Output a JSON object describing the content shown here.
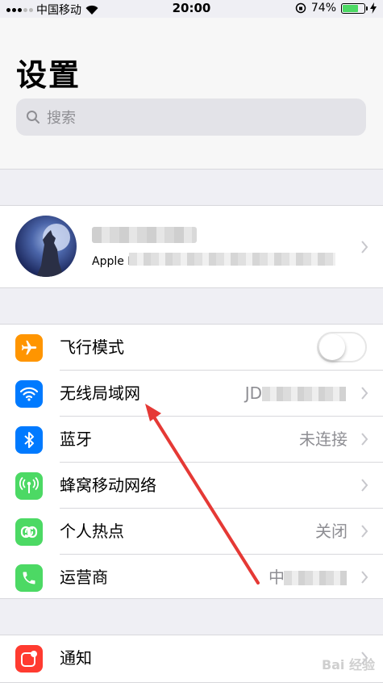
{
  "status_bar": {
    "carrier": "中国移动",
    "time": "20:00",
    "battery": "74%",
    "battery_level": 0.74
  },
  "header": {
    "title": "设置",
    "search_placeholder": "搜索"
  },
  "profile": {
    "subtitle": "Apple ID、iCloud、iTunes"
  },
  "settings": [
    {
      "label": "飞行模式",
      "value": "",
      "icon": "airplane-icon",
      "color": "#ff9500"
    },
    {
      "label": "无线局域网",
      "value": "JD",
      "icon": "wifi-icon",
      "color": "#007aff"
    },
    {
      "label": "蓝牙",
      "value": "未连接",
      "icon": "bluetooth-icon",
      "color": "#007aff"
    },
    {
      "label": "蜂窝移动网络",
      "value": "",
      "icon": "antenna-icon",
      "color": "#4cd964"
    },
    {
      "label": "个人热点",
      "value": "关闭",
      "icon": "hotspot-icon",
      "color": "#4cd964"
    },
    {
      "label": "运营商",
      "value": "中",
      "icon": "phone-icon",
      "color": "#4cd964"
    }
  ],
  "notifications": {
    "label": "通知",
    "icon": "notification-icon",
    "color": "#ff3b30"
  },
  "watermark": "Bai 经验"
}
